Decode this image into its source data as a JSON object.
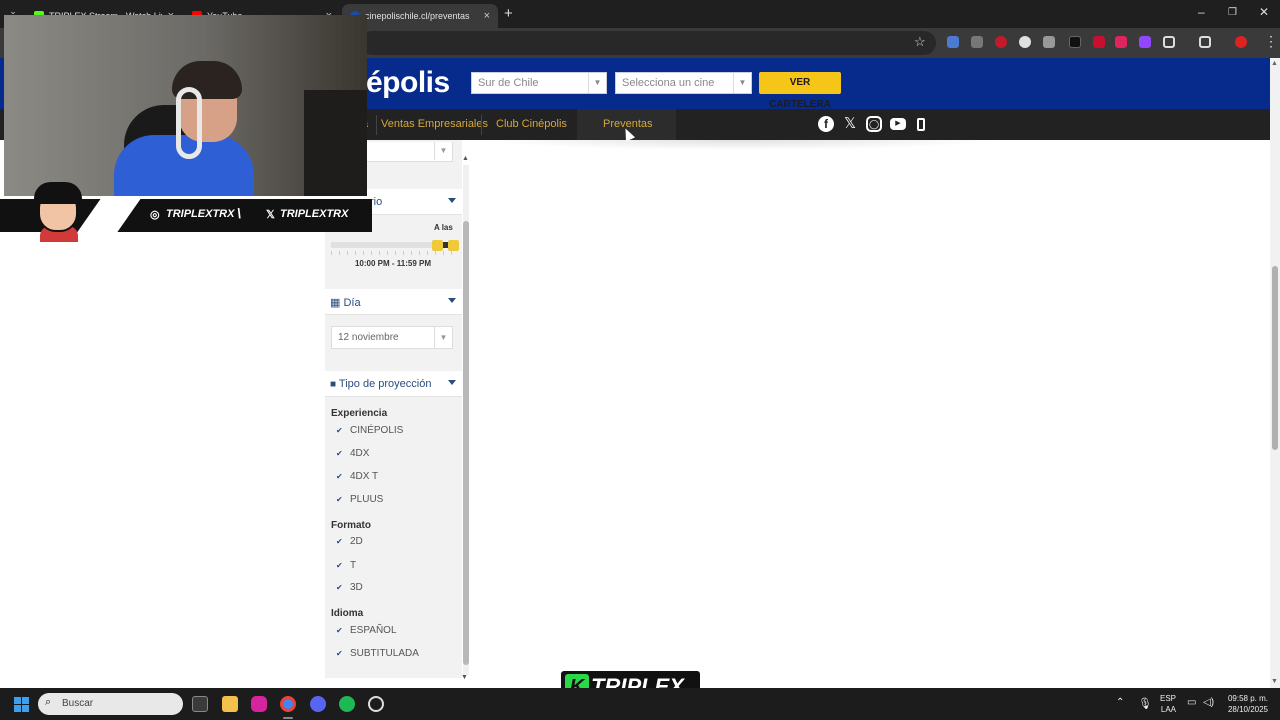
{
  "browser": {
    "tabs": [
      {
        "title": "TRIPLEX Stream - Watch Live on",
        "color": "#53fc18"
      },
      {
        "title": "YouTube",
        "color": "#ff0000"
      },
      {
        "title": "cinepolischile.cl/preventas",
        "color": "#1a4fa0"
      }
    ],
    "active_tab": 2,
    "new_tab": "+",
    "close_glyph": "×",
    "menu_glyph": "⌄",
    "controls": {
      "min": "–",
      "max": "❐",
      "close": "✕"
    }
  },
  "site": {
    "logo": "épolis",
    "region_select": "Sur de Chile",
    "cinema_select": "Selecciona un cine",
    "cartelera_button": "VER CARTELERA",
    "nav": {
      "partial": "a",
      "ventas": "Ventas Empresariales",
      "club": "Club Cinépolis",
      "preventas": "Preventas"
    },
    "social_icons": [
      "facebook-icon",
      "x-icon",
      "instagram-icon",
      "youtube-icon",
      "mobile-icon"
    ]
  },
  "filters": {
    "horario_partial": "rio",
    "slider_label": "A las",
    "slider_range": "10:00 PM - 11:59 PM",
    "slider_value": 0.96,
    "dia_label": "Día",
    "dia_value": "12 noviembre",
    "tipo_label": "Tipo de proyección",
    "groups": [
      {
        "title": "Experiencia",
        "items": [
          "CINÉPOLIS",
          "4DX",
          "4DX T",
          "PLUUS"
        ]
      },
      {
        "title": "Formato",
        "items": [
          "2D",
          "T",
          "3D"
        ]
      },
      {
        "title": "Idioma",
        "items": [
          "ESPAÑOL",
          "SUBTITULADA"
        ]
      }
    ],
    "check_glyph": "✔"
  },
  "overlay": {
    "instagram": "TRIPLEXTRX",
    "x": "TRIPLEXTRX",
    "separator": "\\",
    "stream_logo_k": "K",
    "stream_logo": "TRIPLEX"
  },
  "taskbar": {
    "search": "Buscar",
    "lang": "ESP",
    "lang2": "LAA",
    "time": "09:58 p. m.",
    "date": "28/10/2025"
  }
}
